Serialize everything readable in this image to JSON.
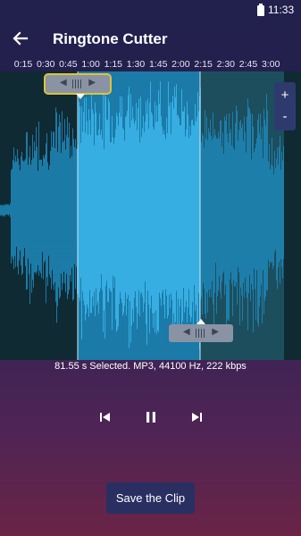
{
  "status": {
    "time": "11:33"
  },
  "app_bar": {
    "title": "Ringtone Cutter",
    "back_icon": "arrow-left-icon"
  },
  "timeline": {
    "ticks": [
      "0:15",
      "0:30",
      "0:45",
      "1:00",
      "1:15",
      "1:30",
      "1:45",
      "2:00",
      "2:15",
      "2:30",
      "2:45",
      "3:00"
    ]
  },
  "waveform": {
    "selection_start_sec": 55,
    "selection_end_sec": 136.55,
    "colors": {
      "background": "#0f2a33",
      "wave": "#1f84b4",
      "selected_bg": "#1b7aa8",
      "selected_wave": "#3ab3e8",
      "after_bg": "#1c4e5e"
    }
  },
  "zoom": {
    "plus": "+",
    "minus": "-"
  },
  "info": {
    "text": "81.55 s Selected. MP3, 44100 Hz, 222 kbps"
  },
  "controls": {
    "prev_icon": "skip-previous-icon",
    "pause_icon": "pause-icon",
    "next_icon": "skip-next-icon"
  },
  "actions": {
    "save_label": "Save the Clip"
  }
}
